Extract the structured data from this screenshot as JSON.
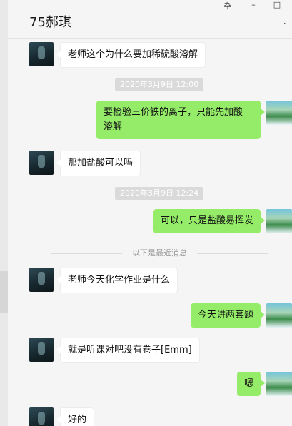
{
  "window": {
    "title": "75郝琪",
    "pin_label": "卆",
    "minimize_label": "–",
    "maximize_label": "□",
    "more_label": "·"
  },
  "messages": [
    {
      "side": "in",
      "text": "老师这个为什么要加稀硫酸溶解"
    },
    {
      "type": "time",
      "text": "2020年3月9日 12:00"
    },
    {
      "side": "out",
      "line1": "要检验三价铁的离子，只能先加酸",
      "line2": "溶解"
    },
    {
      "side": "in",
      "text": "那加盐酸可以吗"
    },
    {
      "type": "time",
      "text": "2020年3月9日 12:24"
    },
    {
      "side": "out",
      "text": "可以，只是盐酸易挥发"
    },
    {
      "type": "divider",
      "text": "以下是最近消息"
    },
    {
      "side": "in",
      "text": "老师今天化学作业是什么"
    },
    {
      "side": "out",
      "text": "今天讲两套题"
    },
    {
      "side": "in",
      "text": "就是听课对吧没有卷子[Emm]"
    },
    {
      "side": "out",
      "text": "嗯"
    },
    {
      "side": "in",
      "text": "好的"
    }
  ],
  "colors": {
    "outgoing_bubble": "#95ec69",
    "incoming_bubble": "#ffffff",
    "background": "#f5f5f5"
  }
}
